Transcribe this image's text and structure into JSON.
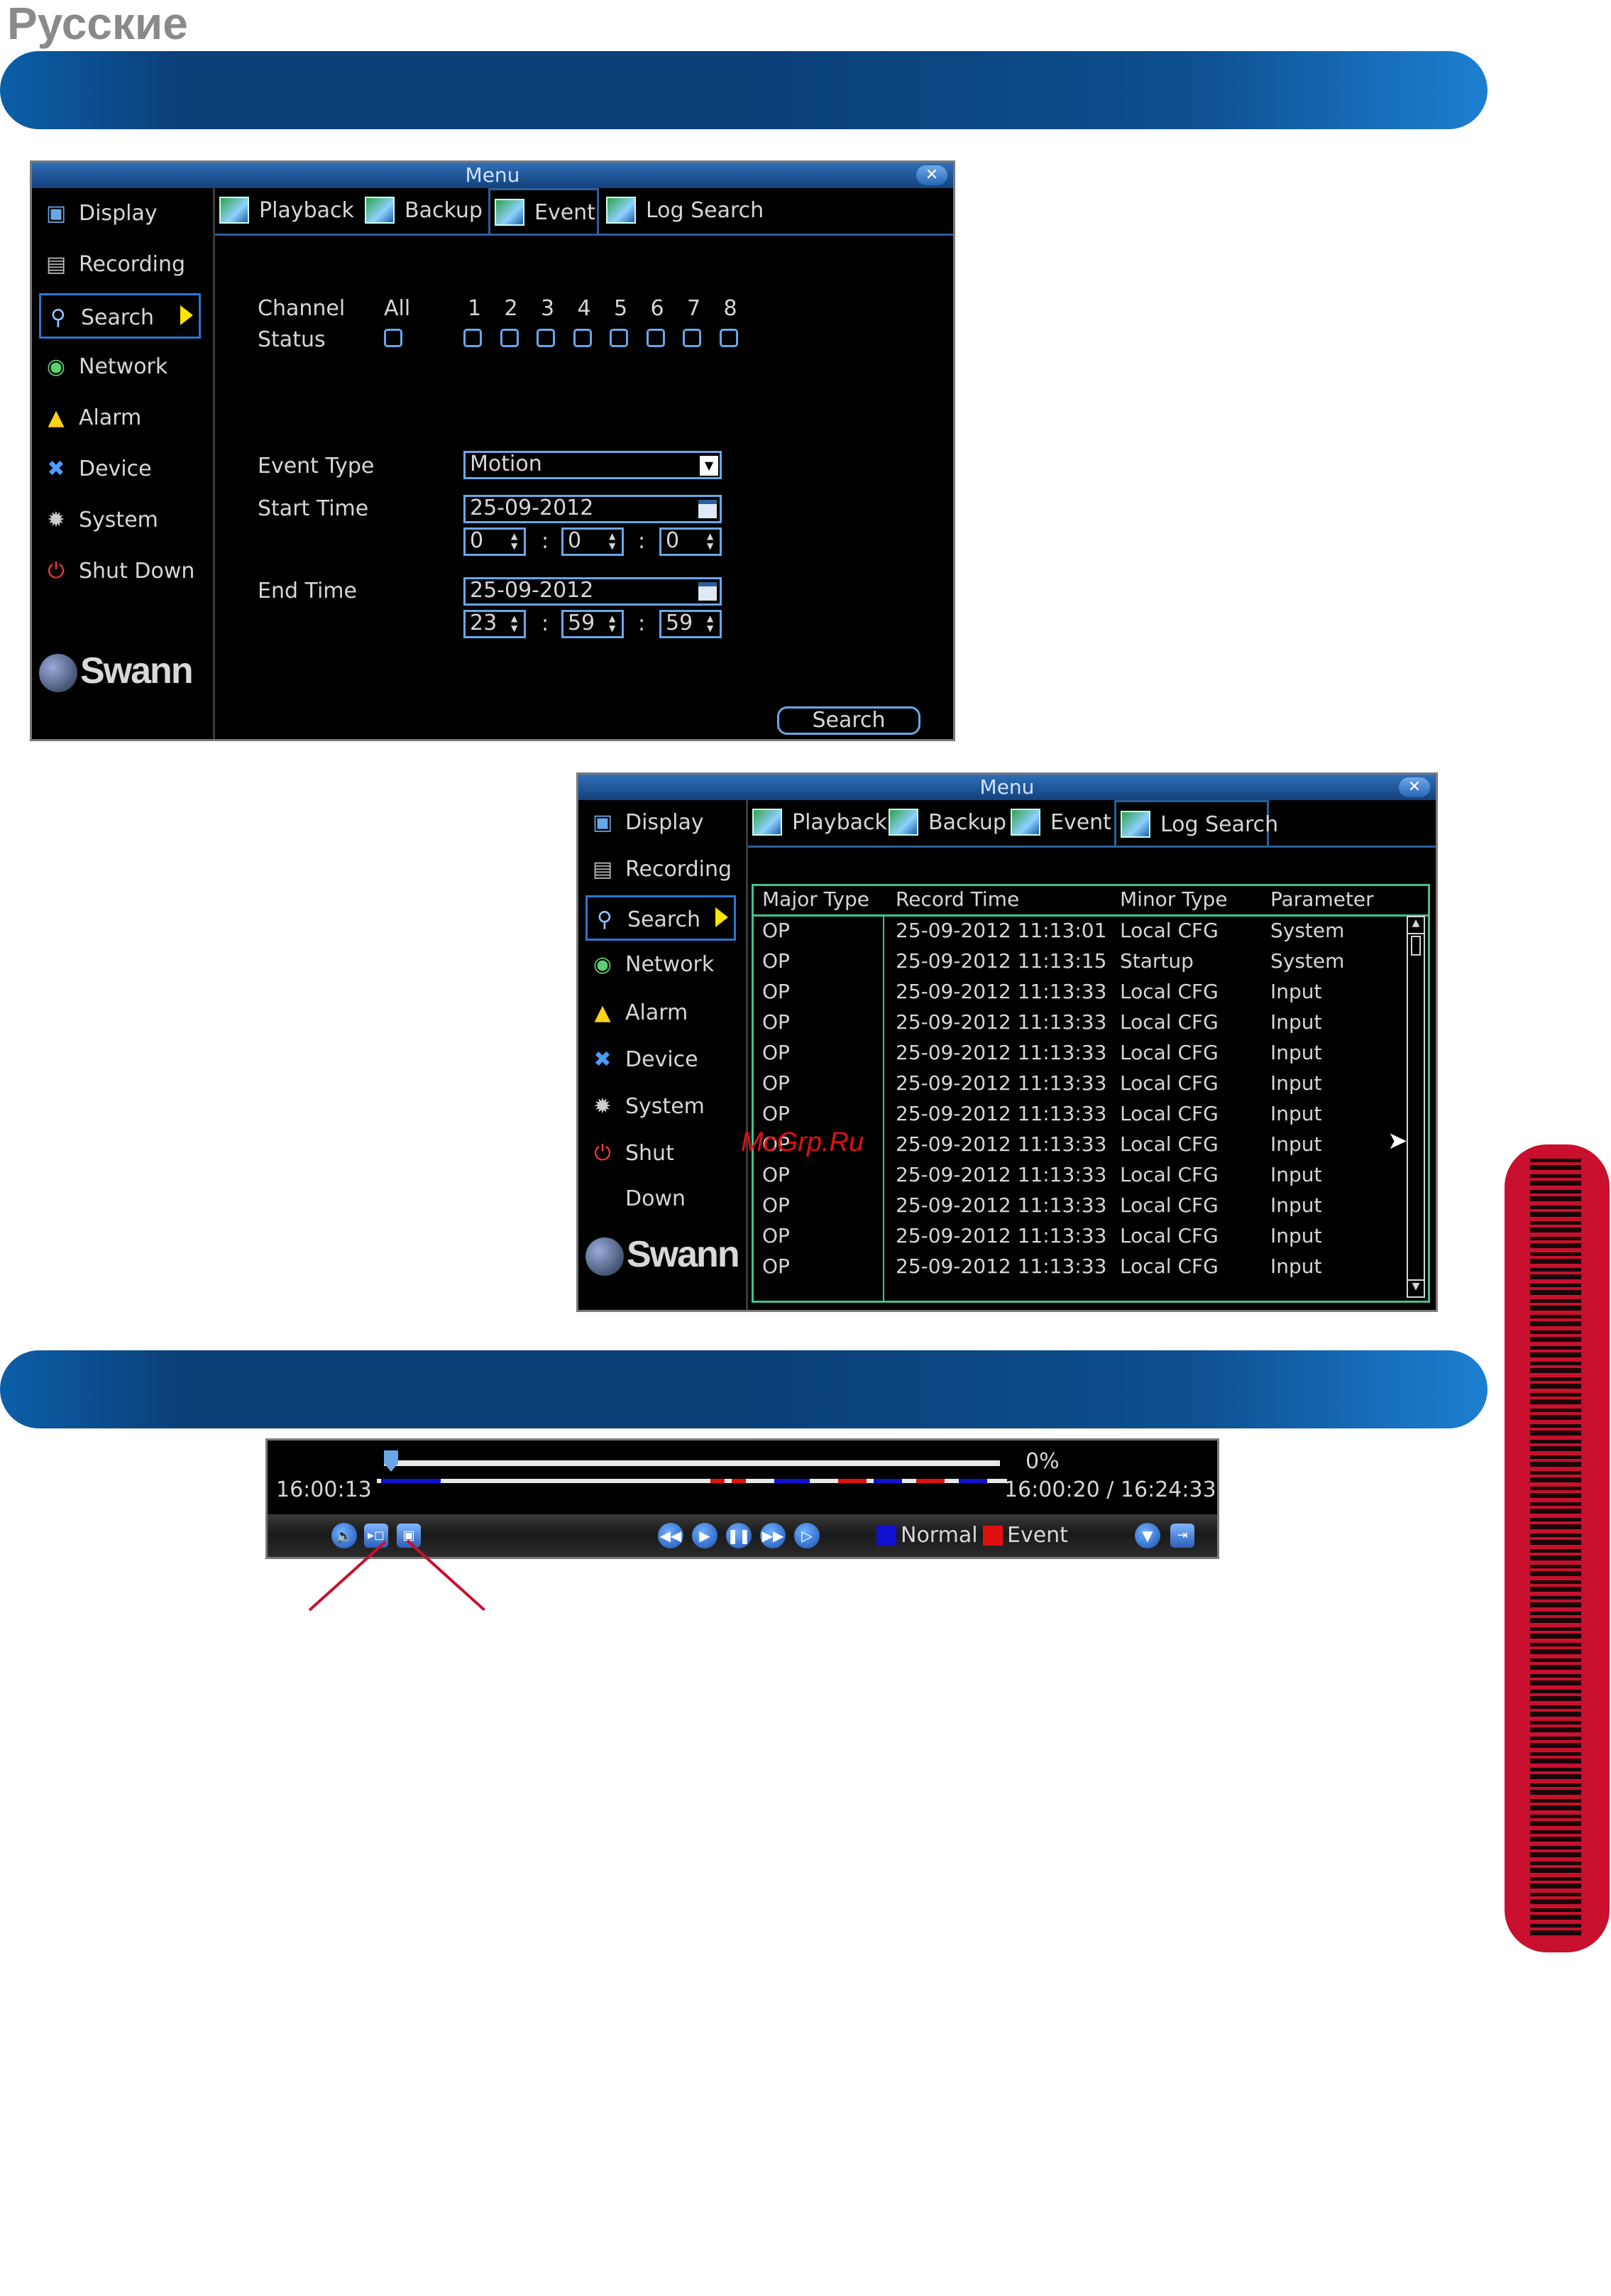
{
  "page": {
    "language_label": "Русские",
    "watermark": "McGrp.Ru"
  },
  "menu": {
    "title": "Menu",
    "close_icon": "close-icon",
    "sidebar": [
      {
        "label": "Display",
        "icon": "display-icon"
      },
      {
        "label": "Recording",
        "icon": "recording-icon"
      },
      {
        "label": "Search",
        "icon": "search-icon",
        "active": true
      },
      {
        "label": "Network",
        "icon": "network-icon"
      },
      {
        "label": "Alarm",
        "icon": "alarm-icon"
      },
      {
        "label": "Device",
        "icon": "device-icon"
      },
      {
        "label": "System",
        "icon": "system-icon"
      },
      {
        "label": "Shut Down",
        "icon": "power-icon"
      }
    ],
    "logo": "Swann",
    "tabs": [
      "Playback",
      "Backup",
      "Event",
      "Log Search"
    ]
  },
  "event_search": {
    "channel_label": "Channel",
    "status_label": "Status",
    "all_label": "All",
    "channels": [
      "1",
      "2",
      "3",
      "4",
      "5",
      "6",
      "7",
      "8"
    ],
    "event_type_label": "Event Type",
    "event_type_value": "Motion",
    "start_time_label": "Start Time",
    "start_date": "25-09-2012",
    "start_h": "0",
    "start_m": "0",
    "start_s": "0",
    "end_time_label": "End Time",
    "end_date": "25-09-2012",
    "end_h": "23",
    "end_m": "59",
    "end_s": "59",
    "time_sep": ":",
    "search_button": "Search"
  },
  "log_search": {
    "columns": [
      "Major Type",
      "Record Time",
      "Minor Type",
      "Parameter"
    ],
    "rows": [
      [
        "OP",
        "25-09-2012 11:13:01",
        "Local CFG",
        "System"
      ],
      [
        "OP",
        "25-09-2012 11:13:15",
        "Startup",
        "System"
      ],
      [
        "OP",
        "25-09-2012 11:13:33",
        "Local CFG",
        "Input"
      ],
      [
        "OP",
        "25-09-2012 11:13:33",
        "Local CFG",
        "Input"
      ],
      [
        "OP",
        "25-09-2012 11:13:33",
        "Local CFG",
        "Input"
      ],
      [
        "OP",
        "25-09-2012 11:13:33",
        "Local CFG",
        "Input"
      ],
      [
        "OP",
        "25-09-2012 11:13:33",
        "Local CFG",
        "Input"
      ],
      [
        "OP",
        "25-09-2012 11:13:33",
        "Local CFG",
        "Input"
      ],
      [
        "OP",
        "25-09-2012 11:13:33",
        "Local CFG",
        "Input"
      ],
      [
        "OP",
        "25-09-2012 11:13:33",
        "Local CFG",
        "Input"
      ],
      [
        "OP",
        "25-09-2012 11:13:33",
        "Local CFG",
        "Input"
      ],
      [
        "OP",
        "25-09-2012 11:13:33",
        "Local CFG",
        "Input"
      ]
    ]
  },
  "playback": {
    "progress_percent": 0,
    "progress_label": "0%",
    "current_time": "16:00:13",
    "time_range": "16:00:20 / 16:24:33",
    "legend_normal": "Normal",
    "legend_event": "Event",
    "colors": {
      "normal": "#1010d0",
      "event": "#e01010"
    }
  }
}
